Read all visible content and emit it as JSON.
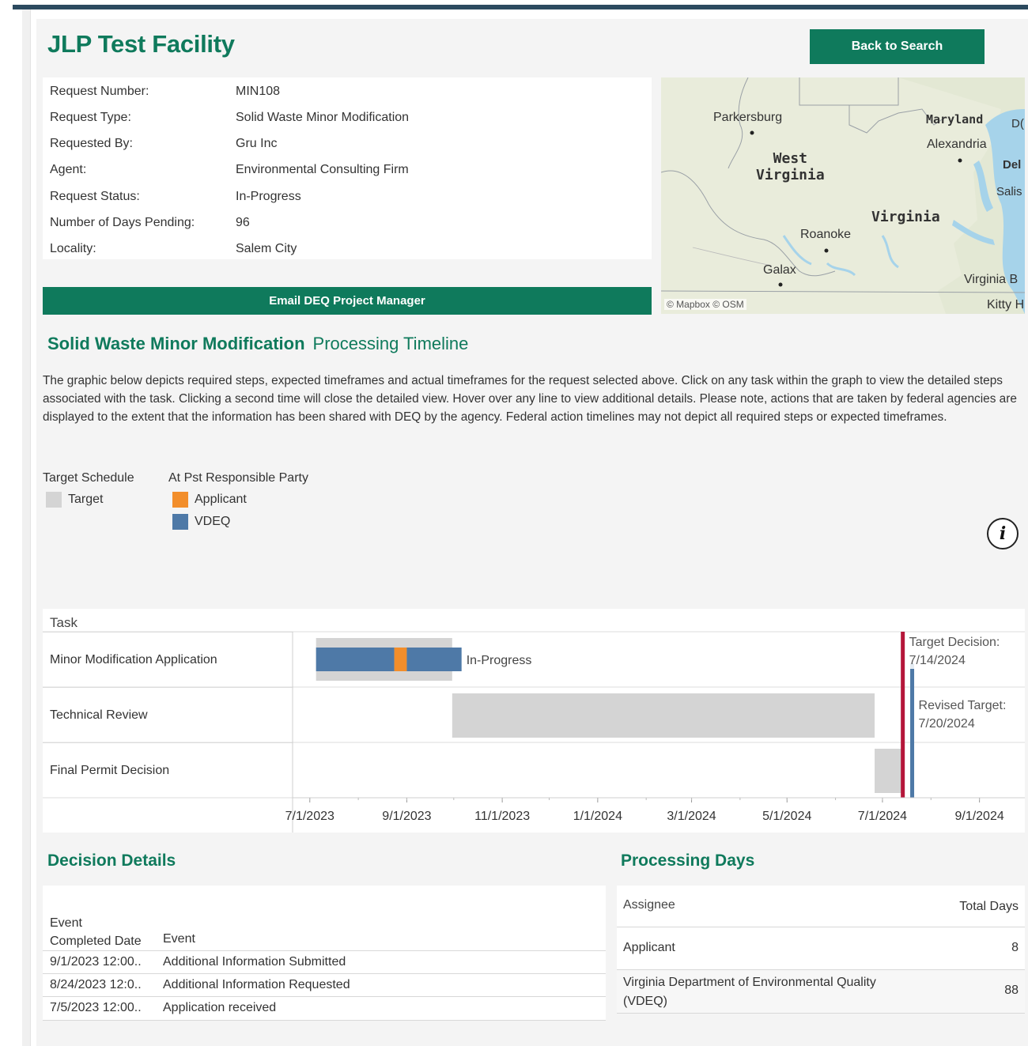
{
  "header": {
    "title": "JLP Test Facility",
    "back_button": "Back to Search"
  },
  "request_info": [
    {
      "label": "Request Number:",
      "value": "MIN108"
    },
    {
      "label": "Request Type:",
      "value": "Solid Waste Minor Modification"
    },
    {
      "label": "Requested By:",
      "value": "Gru Inc"
    },
    {
      "label": "Agent:",
      "value": "Environmental Consulting Firm"
    },
    {
      "label": "Request Status:",
      "value": "In-Progress"
    },
    {
      "label": "Number of Days Pending:",
      "value": "96"
    },
    {
      "label": "Locality:",
      "value": "Salem City"
    }
  ],
  "email_button": "Email DEQ Project Manager",
  "map": {
    "places": {
      "parkersburg": "Parkersburg",
      "west_virginia": "West\nVirginia",
      "maryland": "Maryland",
      "alexandria": "Alexandria",
      "virginia": "Virginia",
      "roanoke": "Roanoke",
      "galax": "Galax",
      "virginia_beach": "Virginia B",
      "kitty": "Kitty H",
      "del": "Del",
      "salis": "Salis",
      "dc": "D("
    },
    "attribution": "© Mapbox  © OSM"
  },
  "timeline": {
    "title_bold": "Solid Waste Minor Modification",
    "title_light": "Processing Timeline",
    "description": "The graphic below depicts required steps, expected timeframes and actual timeframes for the request selected above. Click on any task within the graph to view the detailed steps associated with the task. Clicking a second time will close the detailed view. Hover over any line to view additional details.  Please note, actions that are taken by federal agencies are displayed to the extent that the information has been shared with DEQ by the agency. Federal action timelines may not depict all required steps or expected timeframes.",
    "legend": {
      "schedule_title": "Target Schedule",
      "target_label": "Target",
      "party_title": "At Pst Responsible Party",
      "applicant_label": "Applicant",
      "vdeq_label": "VDEQ"
    },
    "colors": {
      "target": "#d4d4d4",
      "applicant": "#f28e2b",
      "vdeq": "#4e79a7",
      "target_line": "#b5163a",
      "revised_line": "#4e79a7"
    },
    "info_icon": "info-icon"
  },
  "chart_data": {
    "type": "gantt",
    "task_header": "Task",
    "tasks": [
      "Minor Modification Application",
      "Technical Review",
      "Final Permit Decision"
    ],
    "x_ticks": [
      "7/1/2023",
      "9/1/2023",
      "11/1/2023",
      "1/1/2024",
      "3/1/2024",
      "5/1/2024",
      "7/1/2024",
      "9/1/2024"
    ],
    "x_range": [
      "2023-06-20",
      "2024-09-30"
    ],
    "target_bars": [
      {
        "task": 0,
        "start": "2023-07-05",
        "end": "2023-09-30"
      },
      {
        "task": 1,
        "start": "2023-09-30",
        "end": "2024-06-26"
      },
      {
        "task": 2,
        "start": "2024-06-26",
        "end": "2024-07-14"
      }
    ],
    "actual_bars": [
      {
        "task": 0,
        "party": "VDEQ",
        "start": "2023-07-05",
        "end": "2023-08-24"
      },
      {
        "task": 0,
        "party": "Applicant",
        "start": "2023-08-24",
        "end": "2023-09-01"
      },
      {
        "task": 0,
        "party": "VDEQ",
        "start": "2023-09-01",
        "end": "2023-10-06"
      }
    ],
    "status_label": "In-Progress",
    "reference_lines": [
      {
        "name": "Target Decision",
        "date": "2024-07-14",
        "label_title": "Target Decision:",
        "label_date": "7/14/2024"
      },
      {
        "name": "Revised Target",
        "date": "2024-07-20",
        "label_title": "Revised Target:",
        "label_date": "7/20/2024"
      }
    ]
  },
  "decision_details": {
    "title": "Decision Details",
    "headers": [
      "Event\nCompleted Date",
      "Event"
    ],
    "rows": [
      {
        "date": "9/1/2023 12:00..",
        "event": "Additional Information Submitted"
      },
      {
        "date": "8/24/2023 12:0..",
        "event": "Additional Information Requested"
      },
      {
        "date": "7/5/2023 12:00..",
        "event": "Application received"
      }
    ]
  },
  "processing_days": {
    "title": "Processing Days",
    "headers": [
      "Assignee",
      "Total Days"
    ],
    "rows": [
      {
        "assignee": "Applicant",
        "days": "8"
      },
      {
        "assignee": "Virginia Department of Environmental Quality (VDEQ)",
        "days": "88"
      }
    ]
  }
}
